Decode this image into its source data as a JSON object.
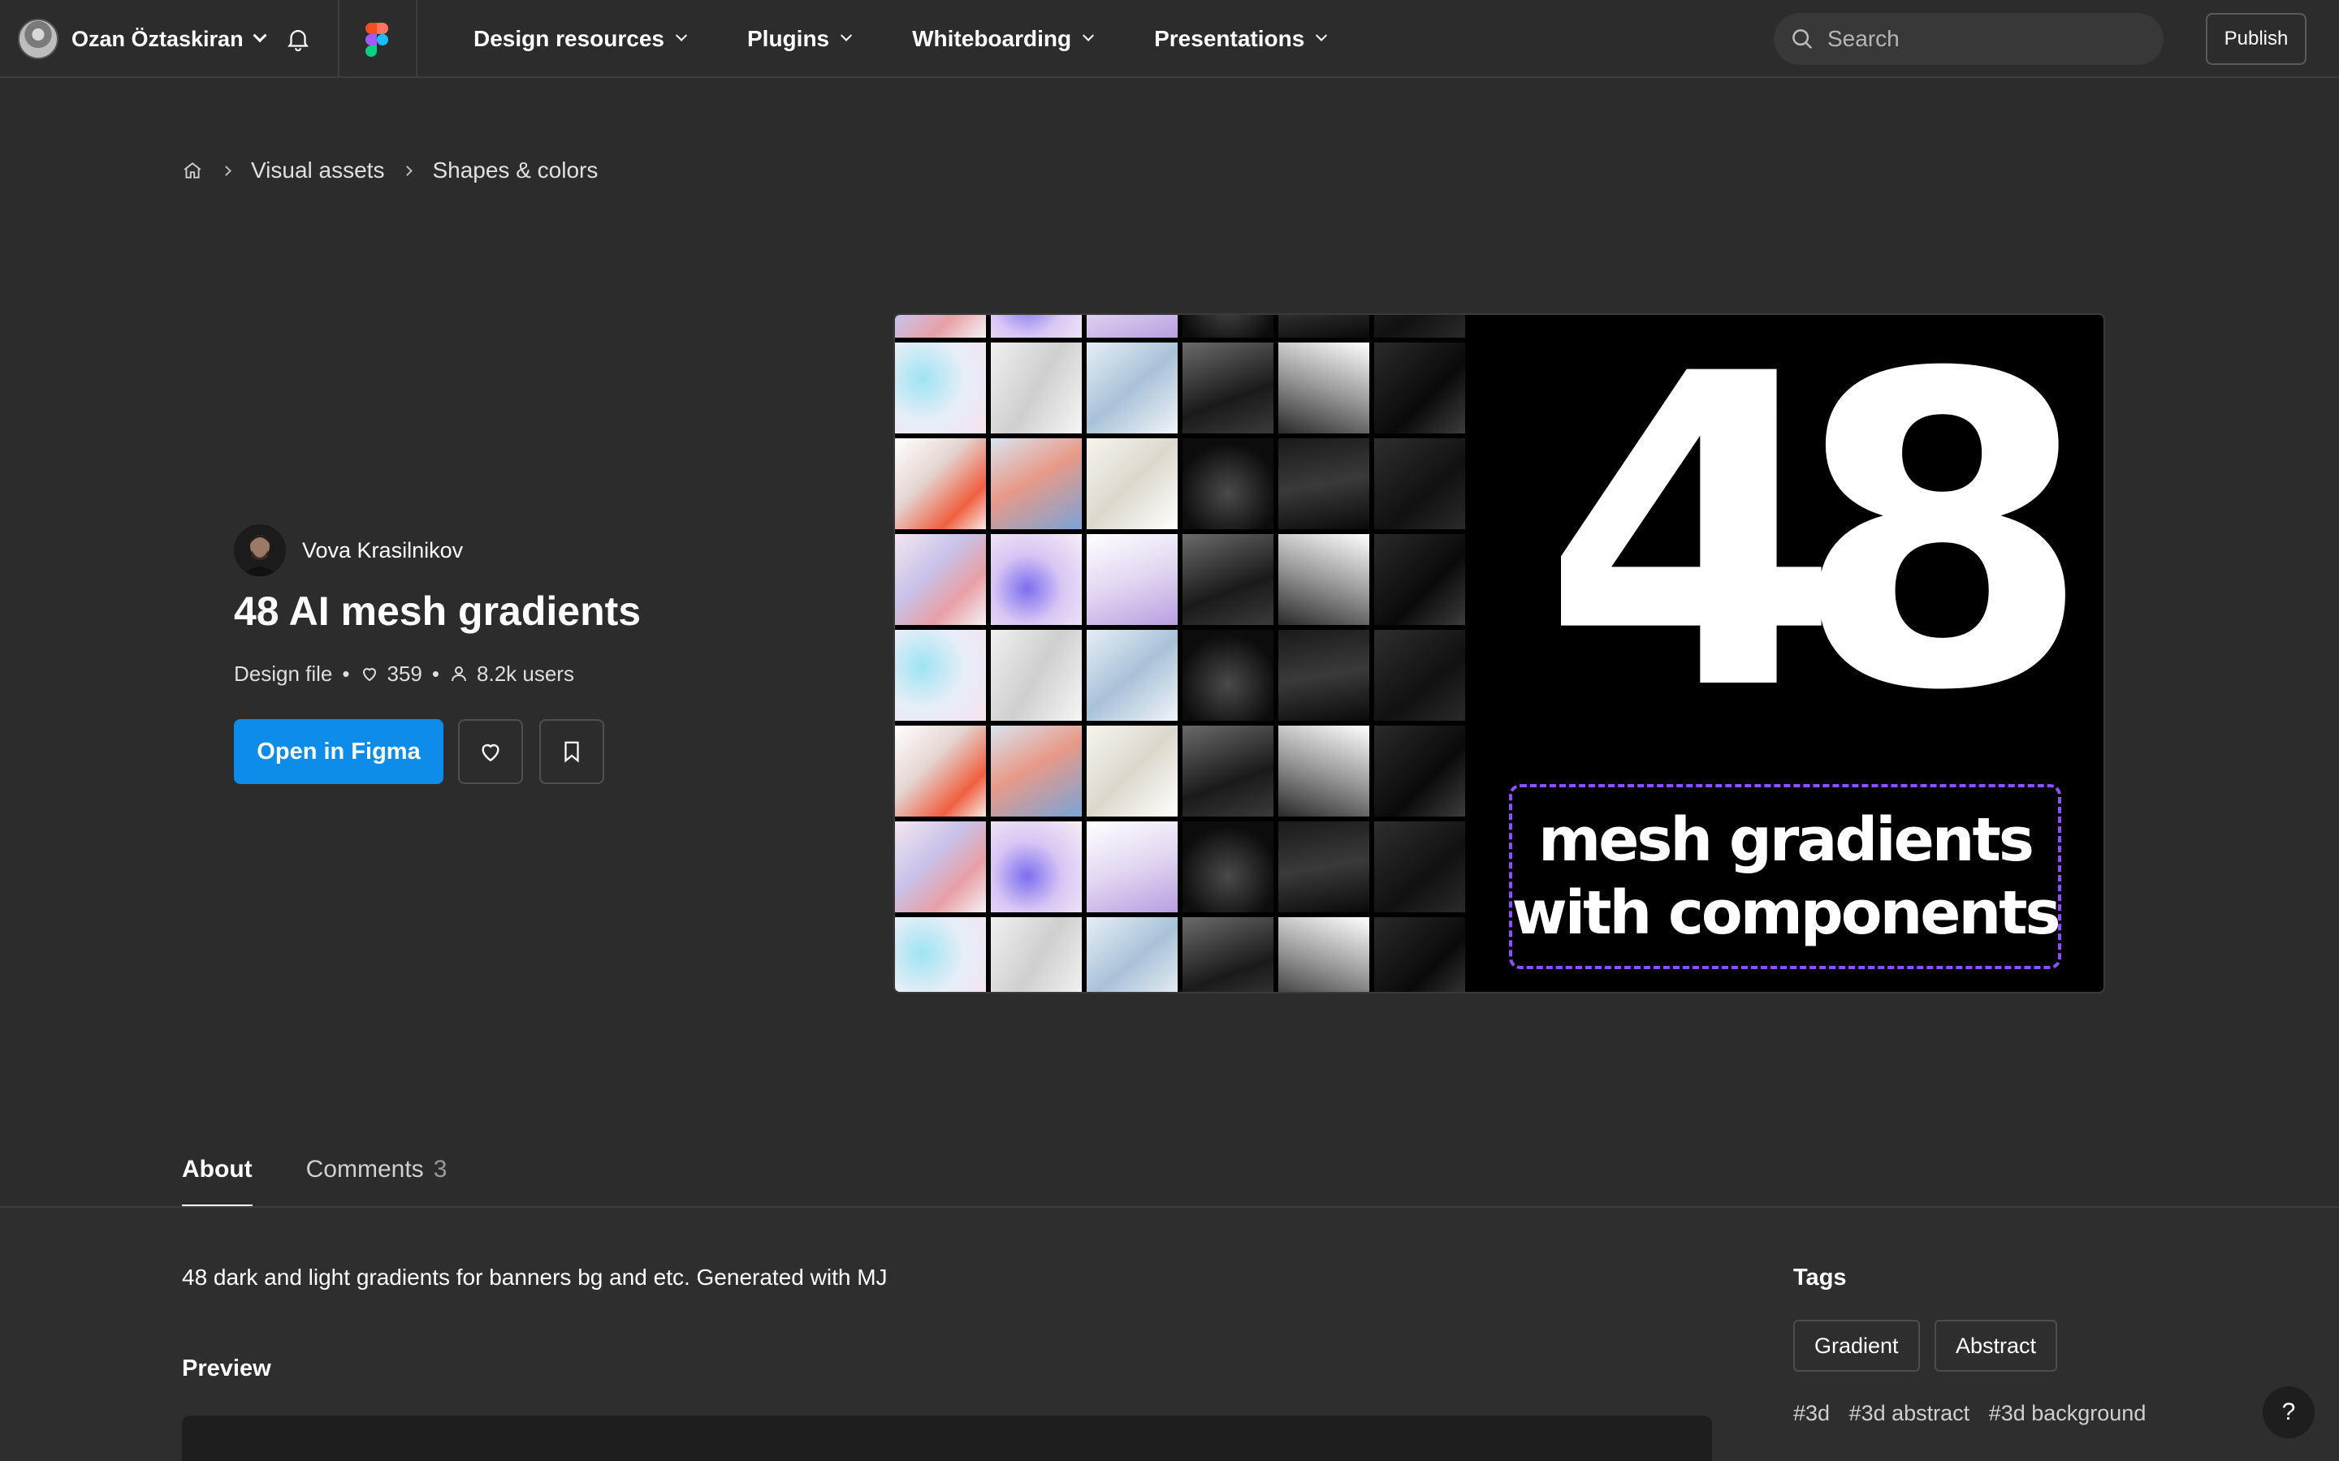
{
  "topbar": {
    "user_name": "Ozan Öztaskiran",
    "nav": [
      "Design resources",
      "Plugins",
      "Whiteboarding",
      "Presentations"
    ],
    "search_placeholder": "Search",
    "publish_label": "Publish"
  },
  "breadcrumb": {
    "items": [
      "Visual assets",
      "Shapes & colors"
    ]
  },
  "file": {
    "author": "Vova Krasilnikov",
    "title": "48 AI mesh gradients",
    "type": "Design file",
    "likes": "359",
    "users": "8.2k users",
    "open_label": "Open in Figma"
  },
  "hero": {
    "number": "48",
    "line1": "mesh gradients",
    "line2": "with components"
  },
  "tabs": {
    "about": "About",
    "comments": "Comments",
    "comments_count": "3"
  },
  "about": {
    "description": "48 dark and light gradients for banners bg and etc. Generated with MJ",
    "preview_heading": "Preview",
    "tags_heading": "Tags",
    "tags": [
      "Gradient",
      "Abstract"
    ],
    "hashtags": [
      "#3d",
      "#3d abstract",
      "#3d background"
    ]
  },
  "help_label": "?",
  "colors": {
    "accent": "#0d8ce9",
    "background": "#2c2c2c",
    "dashed_border": "#8f4fff"
  }
}
